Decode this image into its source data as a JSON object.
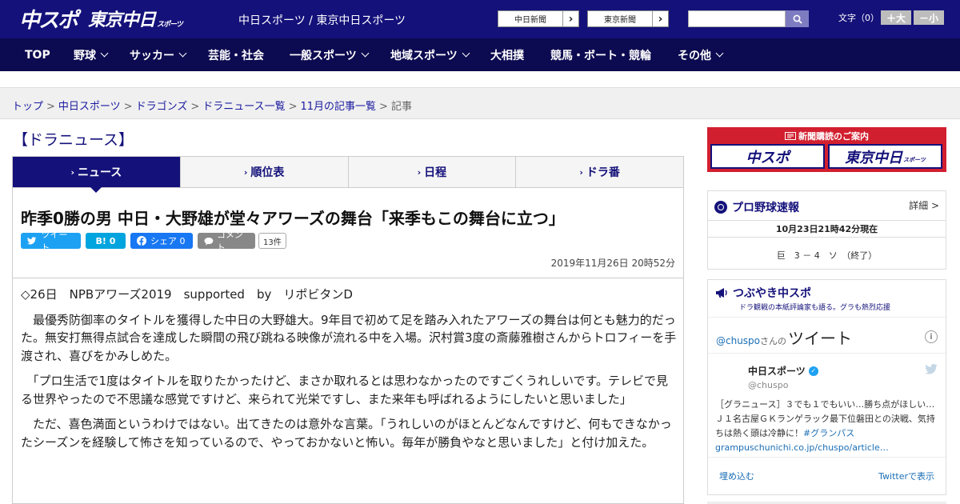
{
  "header": {
    "logo_chuspo": "中スポ",
    "logo_tokyo": "東京中日",
    "logo_tokyo_sub": "スポーツ",
    "site_title": "中日スポーツ / 東京中日スポーツ",
    "ext_links": [
      {
        "label": "中日新聞",
        "arrow": "›"
      },
      {
        "label": "東京新聞",
        "arrow": "›"
      }
    ],
    "search_placeholder": "",
    "font_size_label": "文字（0）",
    "font_plus": "＋大",
    "font_minus": "－小"
  },
  "nav": {
    "items": [
      {
        "label": "TOP"
      },
      {
        "label": "野球"
      },
      {
        "label": "サッカー"
      },
      {
        "label": "芸能・社会"
      },
      {
        "label": "一般スポーツ"
      },
      {
        "label": "地域スポーツ"
      },
      {
        "label": "大相撲"
      },
      {
        "label": "競馬・ボート・競輪"
      },
      {
        "label": "その他"
      }
    ]
  },
  "breadcrumb": {
    "items": [
      "トップ",
      "中日スポーツ",
      "ドラゴンズ",
      "ドラニュース一覧",
      "11月の記事一覧"
    ],
    "current": "記事",
    "separator": ">"
  },
  "main": {
    "section_heading": "【ドラニュース】",
    "tabs": [
      {
        "label": "ニュース",
        "caret": "›"
      },
      {
        "label": "順位表",
        "caret": "›"
      },
      {
        "label": "日程",
        "caret": "›"
      },
      {
        "label": "ドラ番",
        "caret": "›"
      }
    ],
    "article": {
      "headline": "昨季0勝の男 中日・大野雄が堂々アワーズの舞台「来季もこの舞台に立つ」",
      "share": {
        "tweet": "ツイート",
        "hatena": "B! 0",
        "facebook": "シェア 0",
        "comment": "コメント",
        "comment_count": "13件"
      },
      "date": "2019年11月26日 20時52分",
      "paragraphs": [
        "◇26日　NPBアワーズ2019　supported　by　リポビタンD",
        "　最優秀防御率のタイトルを獲得した中日の大野雄大。9年目で初めて足を踏み入れたアワーズの舞台は何とも魅力的だった。無安打無得点試合を達成した瞬間の飛び跳ねる映像が流れる中を入場。沢村賞3度の斎藤雅樹さんからトロフィーを手渡され、喜びをかみしめた。",
        "　「プロ生活で1度はタイトルを取りたかったけど、まさか取れるとは思わなかったのですごくうれしいです。テレビで見る世界やったので不思議な感覚ですけど、来られて光栄ですし、また来年も呼ばれるようにしたいと思いました」",
        "　ただ、喜色満面というわけではない。出てきたのは意外な言葉。「うれしいのがほとんどなんですけど、何もできなかったシーズンを経験して怖さを知っているので、やっておかないと怖い。毎年が勝負やなと思いました」と付け加えた。"
      ]
    }
  },
  "sidebar": {
    "promo": {
      "title": "新聞購読のご案内",
      "logo_left": "中スポ",
      "logo_right": "東京中日",
      "logo_right_sub": "スポーツ"
    },
    "score": {
      "title": "プロ野球速報",
      "detail": "詳細 >",
      "time": "10月23日21時42分現在",
      "line": "巨　3 － 4　ソ　（終了）"
    },
    "tweets": {
      "title": "つぶやき中スポ",
      "subtitle": "ドラ観戦の本紙評論家も語る。グラも熱烈応援",
      "handle": "@chuspo",
      "san": "さんの",
      "big_label": "ツイート",
      "info": "i",
      "user_name": "中日スポーツ",
      "user_handle": "@chuspo",
      "text": "［グラニュース］３でも１でもいい…勝ち点がほしい…Ｊ１名古屋ＧＫランゲラック最下位磐田との決戦、気持ちは熱く頭は冷静に！",
      "hashtag": "#グランパス",
      "link": "grampuschunichi.co.jp/chuspo/article…",
      "embed_label": "埋め込む",
      "view_label": "Twitterで表示"
    }
  },
  "colors": {
    "header_bg": "#14117a",
    "nav_bg": "#0c0a50",
    "promo_red": "#d21f2f",
    "tweet_blue": "#1da1f2",
    "facebook_blue": "#1877f2"
  },
  "icons": [
    "search-icon",
    "chevron-down-icon",
    "baseball-icon",
    "megaphone-icon",
    "twitter-bird-icon",
    "info-icon",
    "verified-icon",
    "comment-icon",
    "newspaper-icon"
  ]
}
